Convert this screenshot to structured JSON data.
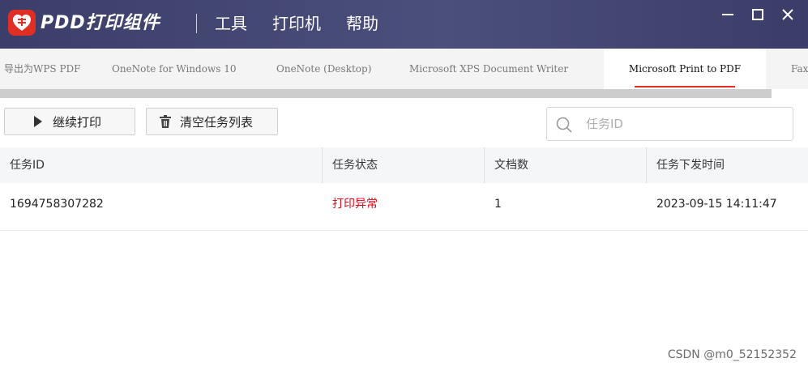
{
  "app": {
    "brand": "PDD打印组件",
    "menu": [
      "工具",
      "打印机",
      "帮助"
    ],
    "window_controls": [
      "minimize-icon",
      "maximize-icon",
      "close-icon"
    ]
  },
  "tabs": {
    "items": [
      "导出为WPS PDF",
      "OneNote for Windows 10",
      "OneNote (Desktop)",
      "Microsoft XPS Document Writer",
      "Microsoft Print to PDF",
      "Fax"
    ],
    "active": "Microsoft Print to PDF"
  },
  "toolbar": {
    "continue_label": "继续打印",
    "clear_label": "清空任务列表",
    "search_placeholder": "任务ID"
  },
  "table": {
    "columns": [
      "任务ID",
      "任务状态",
      "文档数",
      "任务下发时间"
    ],
    "rows": [
      {
        "id": "1694758307282",
        "status": "打印异常",
        "docs": "1",
        "time": "2023-09-15 14:11:47"
      }
    ]
  },
  "watermark": "CSDN @m0_52152352",
  "colors": {
    "titlebar": "#3b3e69",
    "accent": "#e02e24",
    "error": "#e60012"
  }
}
